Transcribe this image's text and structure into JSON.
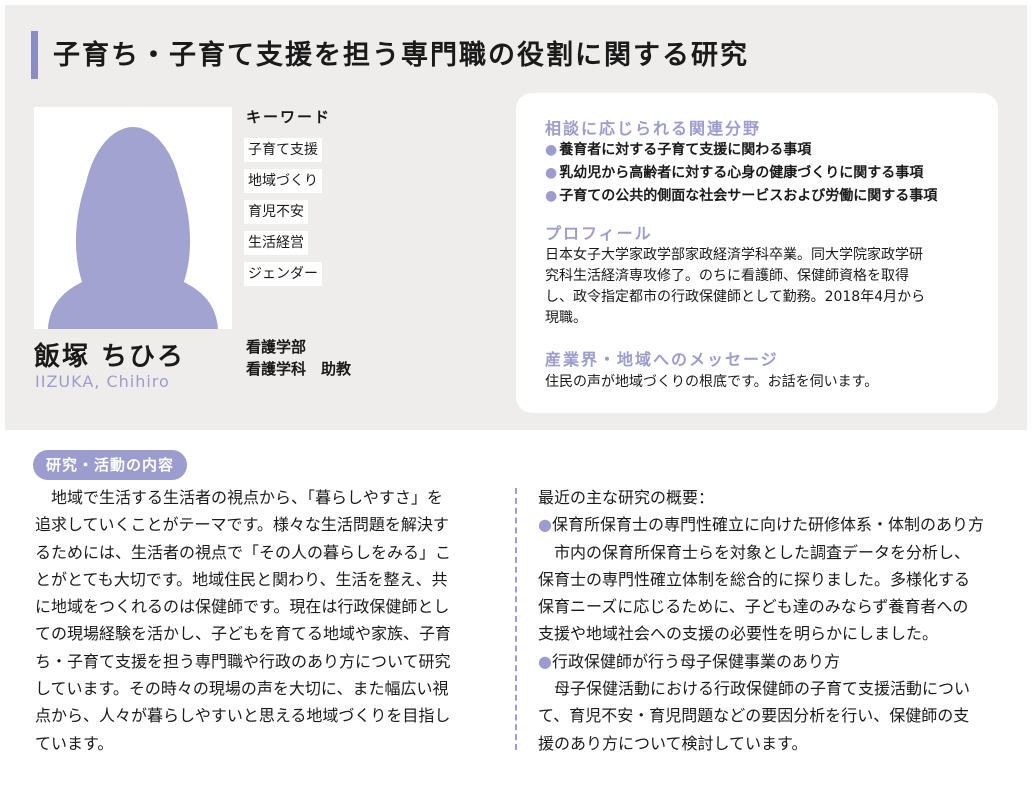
{
  "title": "子育ち・子育て支援を担う専門職の役割に関する研究",
  "person": {
    "name": "飯塚 ちひろ",
    "romaji": "IIZUKA, Chihiro",
    "faculty": "看護学部",
    "position": "看護学科　助教"
  },
  "keywords": {
    "label": "キーワード",
    "items": [
      "子育て支援",
      "地域づくり",
      "育児不安",
      "生活経営",
      "ジェンダー"
    ]
  },
  "card": {
    "consult_title": "相談に応じられる関連分野",
    "consult_items": [
      "養育者に対する子育て支援に関わる事項",
      "乳幼児から高齢者に対する心身の健康づくりに関する事項",
      "子育ての公共的側面な社会サービスおよび労働に関する事項"
    ],
    "profile_title": "プロフィール",
    "profile_text": "日本女子大学家政学部家政経済学科卒業。同大学院家政学研\n究科生活経済専攻修了。のちに看護師、保健師資格を取得\nし、政令指定都市の行政保健師として勤務。2018年4月から\n現職。",
    "message_title": "産業界・地域へのメッセージ",
    "message_text": "住民の声が地域づくりの根底です。お話を伺います。"
  },
  "research": {
    "section_label": "研究・活動の内容",
    "left_text": "　地域で生活する生活者の視点から、「暮らしやすさ」を\n追求していくことがテーマです。様々な生活問題を解決す\nるためには、生活者の視点で「その人の暮らしをみる」こ\nとがとても大切です。地域住民と関わり、生活を整え、共\nに地域をつくれるのは保健師です。現在は行政保健師とし\nての現場経験を活かし、子どもを育てる地域や家族、子育\nち・子育て支援を担う専門職や行政のあり方について研究\nしています。その時々の現場の声を大切に、また幅広い視\n点から、人々が暮らしやすいと思える地域づくりを目指し\nています。",
    "right_intro": "最近の主な研究の概要：",
    "topic1_title": "保育所保育士の専門性確立に向けた研修体系・体制のあり方",
    "topic1_text": "　市内の保育所保育士らを対象とした調査データを分析し、\n保育士の専門性確立体制を総合的に探りました。多様化する\n保育ニーズに応じるために、子ども達のみならず養育者への\n支援や地域社会への支援の必要性を明らかにしました。",
    "topic2_title": "行政保健師が行う母子保健事業のあり方",
    "topic2_text": "　母子保健活動における行政保健師の子育て支援活動につい\nて、育児不安・育児問題などの要因分析を行い、保健師の支\n援のあり方について検討しています。"
  },
  "colors": {
    "accent": "#9c9ccf",
    "panel_bg": "#efedeb",
    "silhouette": "#a3a3d1"
  },
  "icons": {
    "bullet": "●",
    "photo": "person-silhouette-icon"
  }
}
